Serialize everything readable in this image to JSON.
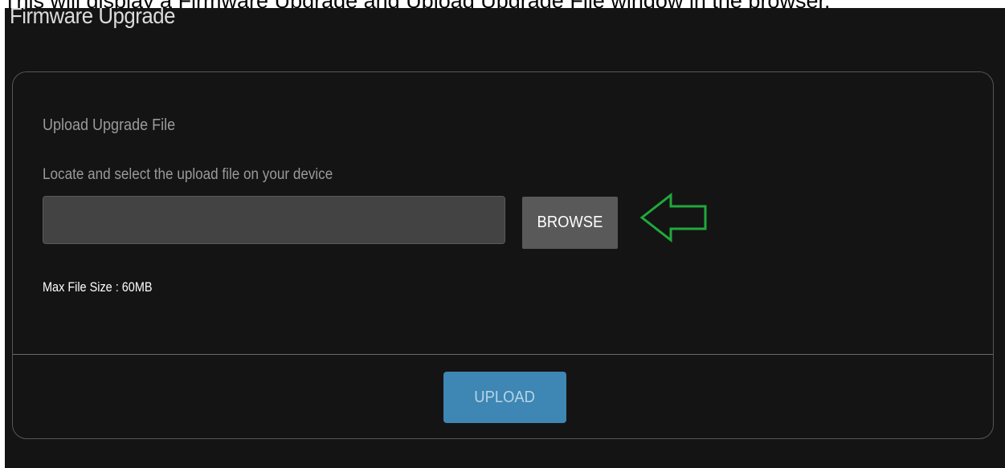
{
  "caption": "This will display a Firmware Upgrade and Upload Upgrade File window in the browser.",
  "page": {
    "title": "Firmware Upgrade"
  },
  "upload_card": {
    "section_title": "Upload Upgrade File",
    "instruction": "Locate and select the upload file on your device",
    "file_input_value": "",
    "browse_label": "BROWSE",
    "max_file_size": "Max File Size : 60MB",
    "upload_label": "UPLOAD"
  },
  "annotation": {
    "icon": "left-arrow-icon",
    "color": "#21a83b"
  },
  "colors": {
    "background": "#141414",
    "upload_button": "#3e86b3",
    "browse_button": "#595959"
  }
}
